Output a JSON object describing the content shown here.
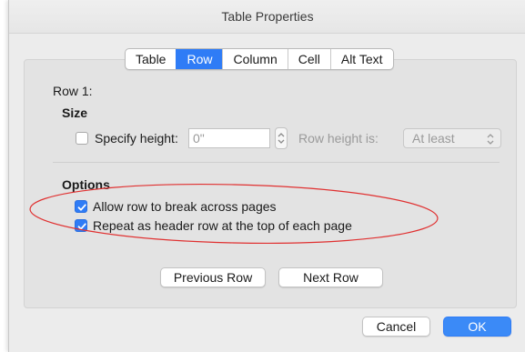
{
  "window": {
    "title": "Table Properties"
  },
  "tabs": [
    {
      "label": "Table",
      "active": false
    },
    {
      "label": "Row",
      "active": true
    },
    {
      "label": "Column",
      "active": false
    },
    {
      "label": "Cell",
      "active": false
    },
    {
      "label": "Alt Text",
      "active": false
    }
  ],
  "row_label": "Row 1:",
  "size": {
    "heading": "Size",
    "specify_height_label": "Specify height:",
    "specify_height_checked": false,
    "height_value": "0\"",
    "row_height_is_label": "Row height is:",
    "row_height_mode": "At least"
  },
  "options": {
    "heading": "Options",
    "allow_break_label": "Allow row to break across pages",
    "allow_break_checked": true,
    "repeat_header_label": "Repeat as header row at the top of each page",
    "repeat_header_checked": true
  },
  "nav": {
    "previous_label": "Previous Row",
    "next_label": "Next Row"
  },
  "footer": {
    "cancel_label": "Cancel",
    "ok_label": "OK"
  },
  "colors": {
    "accent": "#2f7cf6",
    "annotation": "#e03030",
    "window_bg": "#ececec"
  }
}
